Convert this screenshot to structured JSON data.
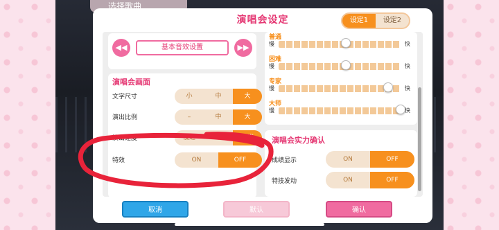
{
  "behind_title": "选择歌曲",
  "dialog": {
    "title": "演唱会设定",
    "presets": [
      "设定1",
      "设定2"
    ],
    "active_preset": 0
  },
  "sound": {
    "button_label": "基本音效设置",
    "prev_icon": "double-chevron-left-icon",
    "next_icon": "double-chevron-right-icon"
  },
  "screen": {
    "title": "演唱会画面",
    "rows": [
      {
        "label": "文字尺寸",
        "options": [
          "小",
          "中",
          "大"
        ],
        "active": 2
      },
      {
        "label": "演出比例",
        "options": [
          "–",
          "中",
          "大"
        ],
        "active": 2
      },
      {
        "label": "演出速度",
        "options": [
          "慢速",
          "中",
          "通常"
        ],
        "active": 2
      },
      {
        "label": "特效",
        "options": [
          "ON",
          "OFF"
        ],
        "active": 1
      }
    ]
  },
  "speed": {
    "slow_label": "慢",
    "fast_label": "快",
    "rows": [
      {
        "name": "普通",
        "level": 0.55
      },
      {
        "name": "困难",
        "level": 0.55
      },
      {
        "name": "专家",
        "level": 0.9
      },
      {
        "name": "大师",
        "level": 1.0
      }
    ]
  },
  "live": {
    "title": "演唱会实力确认",
    "rows": [
      {
        "label": "成绩显示",
        "options": [
          "ON",
          "OFF"
        ],
        "active": 1
      },
      {
        "label": "特技发动",
        "options": [
          "ON",
          "OFF"
        ],
        "active": 1
      }
    ]
  },
  "footer": {
    "cancel": "取消",
    "default": "默认",
    "confirm": "确认"
  },
  "colors": {
    "accent_pink": "#e53974",
    "accent_orange": "#f7901e",
    "cancel_blue": "#2fa6e8",
    "annotation_red": "#e8233a"
  }
}
